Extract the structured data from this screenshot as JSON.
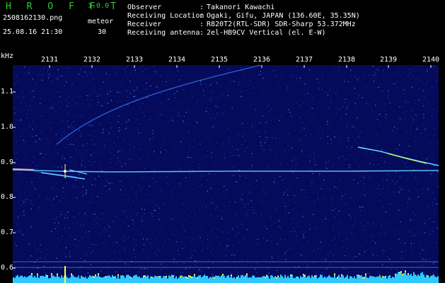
{
  "header": {
    "app_name": "H R O F F T",
    "version": "1.0.0",
    "file_name": "2508162130.png",
    "datetime": "25.08.16 21:30",
    "mode_label": "meteor",
    "meteor_count": "30"
  },
  "info": [
    {
      "key": "Observer",
      "sep": ":",
      "value": "Takanori Kawachi"
    },
    {
      "key": "Receiving Location",
      "sep": ":",
      "value": "Ogaki, Gifu, JAPAN (136.60E, 35.35N)"
    },
    {
      "key": "Receiver",
      "sep": ":",
      "value": "R820T2(RTL-SDR) SDR-Sharp 53.372MHz"
    },
    {
      "key": "Receiving antenna",
      "sep": ":",
      "value": "2el-HB9CV Vertical (el. E-W)"
    }
  ],
  "axis": {
    "unit": "kHz",
    "y_ticks": [
      "1.1",
      "1.0",
      "0.9",
      "0.8",
      "0.7",
      "0.6"
    ],
    "x_ticks": [
      "2131",
      "2132",
      "2133",
      "2134",
      "2135",
      "2136",
      "2137",
      "2138",
      "2139",
      "2140"
    ]
  },
  "colors": {
    "background": "#000000",
    "plot_bg": "#050a5a",
    "title_green": "#2ecc2e",
    "signal_cyan": "#5fd0ff",
    "signal_yellow": "#ffff40",
    "level_bar": "#2cc8ff"
  }
}
